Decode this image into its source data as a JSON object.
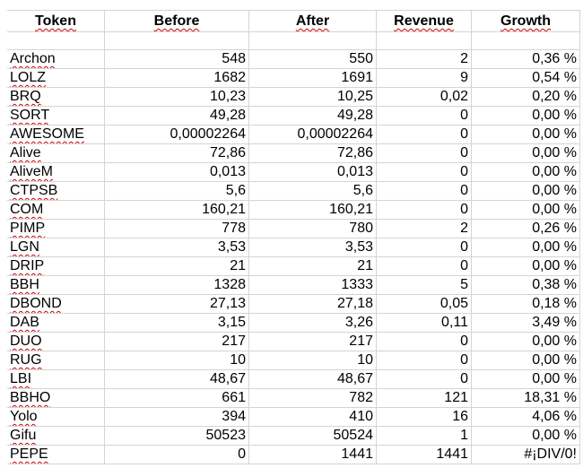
{
  "headers": [
    "Token",
    "Before",
    "After",
    "Revenue",
    "Growth"
  ],
  "rows": [
    [
      "Archon",
      "548",
      "550",
      "2",
      "0,36 %"
    ],
    [
      "LOLZ",
      "1682",
      "1691",
      "9",
      "0,54 %"
    ],
    [
      "BRQ",
      "10,23",
      "10,25",
      "0,02",
      "0,20 %"
    ],
    [
      "SORT",
      "49,28",
      "49,28",
      "0",
      "0,00 %"
    ],
    [
      "AWESOME",
      "0,00002264",
      "0,00002264",
      "0",
      "0,00 %"
    ],
    [
      "Alive",
      "72,86",
      "72,86",
      "0",
      "0,00 %"
    ],
    [
      "AliveM",
      "0,013",
      "0,013",
      "0",
      "0,00 %"
    ],
    [
      "CTPSB",
      "5,6",
      "5,6",
      "0",
      "0,00 %"
    ],
    [
      "COM",
      "160,21",
      "160,21",
      "0",
      "0,00 %"
    ],
    [
      "PIMP",
      "778",
      "780",
      "2",
      "0,26 %"
    ],
    [
      "LGN",
      "3,53",
      "3,53",
      "0",
      "0,00 %"
    ],
    [
      "DRIP",
      "21",
      "21",
      "0",
      "0,00 %"
    ],
    [
      "BBH",
      "1328",
      "1333",
      "5",
      "0,38 %"
    ],
    [
      "DBOND",
      "27,13",
      "27,18",
      "0,05",
      "0,18 %"
    ],
    [
      "DAB",
      "3,15",
      "3,26",
      "0,11",
      "3,49 %"
    ],
    [
      "DUO",
      "217",
      "217",
      "0",
      "0,00 %"
    ],
    [
      "RUG",
      "10",
      "10",
      "0",
      "0,00 %"
    ],
    [
      "LBI",
      "48,67",
      "48,67",
      "0",
      "0,00 %"
    ],
    [
      "BBHO",
      "661",
      "782",
      "121",
      "18,31 %"
    ],
    [
      "Yolo",
      "394",
      "410",
      "16",
      "4,06 %"
    ],
    [
      "Gifu",
      "50523",
      "50524",
      "1",
      "0,00 %"
    ],
    [
      "PEPE",
      "0",
      "1441",
      "1441",
      "#¡DIV/0!"
    ]
  ],
  "colors": {
    "gridline": "#d4d4d4",
    "spellcheck_underline": "#d00000"
  }
}
